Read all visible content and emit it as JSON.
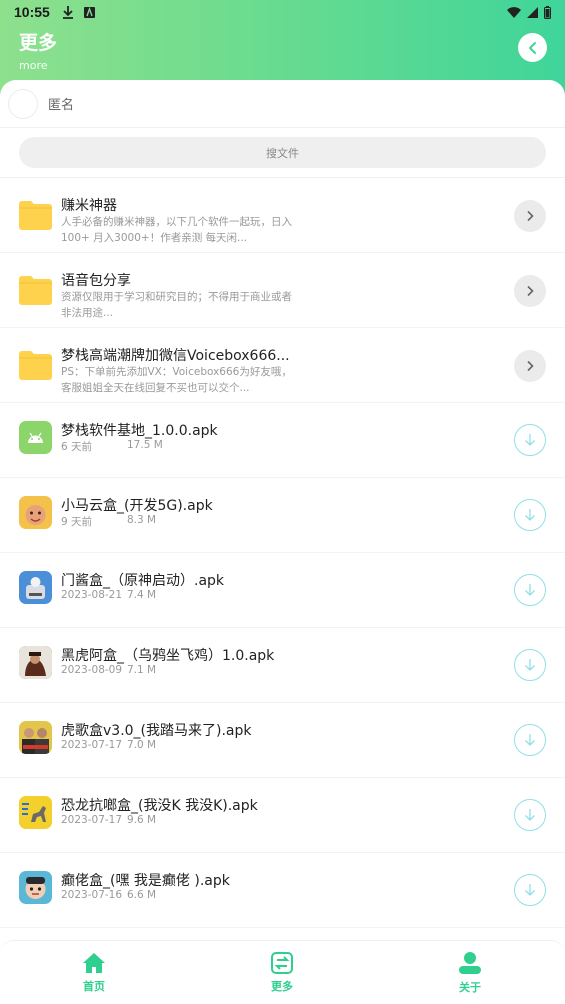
{
  "status_bar": {
    "time": "10:55"
  },
  "header": {
    "title": "更多",
    "subtitle": "more"
  },
  "user": {
    "name": "匿名"
  },
  "search": {
    "placeholder": "搜文件"
  },
  "folders": [
    {
      "title": "赚米神器",
      "desc": "人手必备的赚米神器，以下几个软件一起玩，日入100+ 月入3000+！作者亲测 每天闲..."
    },
    {
      "title": "语音包分享",
      "desc": "资源仅限用于学习和研究目的；不得用于商业或者非法用途..."
    },
    {
      "title": "梦栈高端潮牌加微信Voicebox666...",
      "desc": "PS：下单前先添加VX：Voicebox666为好友哦，客服姐姐全天在线回复不买也可以交个..."
    }
  ],
  "files": [
    {
      "title": "梦栈软件基地_1.0.0.apk",
      "date": "6 天前",
      "size": "17.5 M",
      "icon": "android-icon",
      "color": "#8bd56a"
    },
    {
      "title": "小马云盒_(开发5G).apk",
      "date": "9 天前",
      "size": "8.3 M",
      "icon": "baby-face-icon",
      "color": "#f4c14a"
    },
    {
      "title": "门酱盒_（原神启动）.apk",
      "date": "2023-08-21",
      "size": "7.4 M",
      "icon": "game-character-icon",
      "color": "#4a8fd8"
    },
    {
      "title": "黑虎阿盒_（乌鸦坐飞鸡）1.0.apk",
      "date": "2023-08-09",
      "size": "7.1 M",
      "icon": "tiger-icon",
      "color": "#7a3b2a"
    },
    {
      "title": "虎歌盒v3.0_(我踏马来了).apk",
      "date": "2023-07-17",
      "size": "7.0 M",
      "icon": "people-icon",
      "color": "#e4c54b"
    },
    {
      "title": "恐龙抗啷盒_(我没K 我没K).apk",
      "date": "2023-07-17",
      "size": "9.6 M",
      "icon": "dinosaur-icon",
      "color": "#f3d02c"
    },
    {
      "title": "癫佬盒_(嘿 我是癫佬 ).apk",
      "date": "2023-07-16",
      "size": "6.6 M",
      "icon": "funny-face-icon",
      "color": "#5ab8d6"
    }
  ],
  "nav": [
    {
      "label": "首页",
      "icon": "home-icon"
    },
    {
      "label": "更多",
      "icon": "swap-icon"
    },
    {
      "label": "关于",
      "icon": "user-icon"
    }
  ],
  "colors": {
    "accent": "#2ecf8f",
    "header_start": "#8ee08d",
    "header_end": "#3fd59a",
    "folder": "#ffd24d"
  }
}
